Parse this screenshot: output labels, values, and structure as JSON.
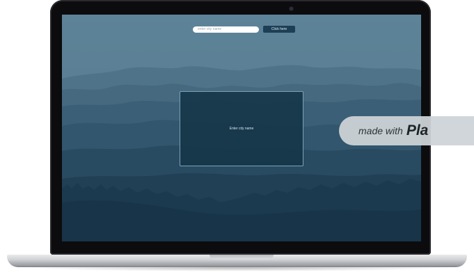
{
  "search": {
    "placeholder": "enter city name",
    "value": "",
    "button_label": "Click here"
  },
  "result": {
    "message": "Enter city name"
  },
  "badge": {
    "text": "made with",
    "logo_text": "Pla"
  },
  "colors": {
    "sky": "#5b8196",
    "button": "#1d3f55",
    "panel": "#143448",
    "panel_border": "#7da3b8",
    "badge": "#cdd3d7"
  }
}
